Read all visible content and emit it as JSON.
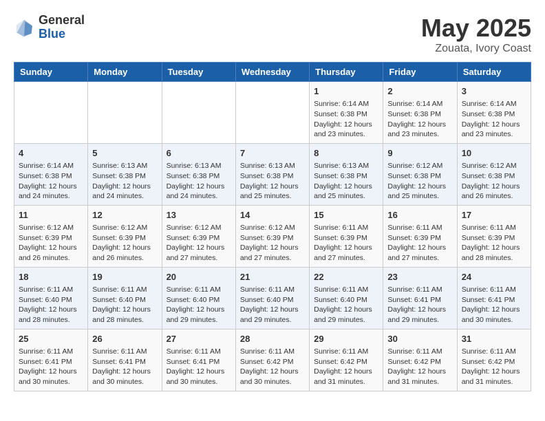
{
  "logo": {
    "general": "General",
    "blue": "Blue"
  },
  "title": "May 2025",
  "subtitle": "Zouata, Ivory Coast",
  "days_of_week": [
    "Sunday",
    "Monday",
    "Tuesday",
    "Wednesday",
    "Thursday",
    "Friday",
    "Saturday"
  ],
  "weeks": [
    [
      {
        "day": "",
        "info": ""
      },
      {
        "day": "",
        "info": ""
      },
      {
        "day": "",
        "info": ""
      },
      {
        "day": "",
        "info": ""
      },
      {
        "day": "1",
        "info": "Sunrise: 6:14 AM\nSunset: 6:38 PM\nDaylight: 12 hours and 23 minutes."
      },
      {
        "day": "2",
        "info": "Sunrise: 6:14 AM\nSunset: 6:38 PM\nDaylight: 12 hours and 23 minutes."
      },
      {
        "day": "3",
        "info": "Sunrise: 6:14 AM\nSunset: 6:38 PM\nDaylight: 12 hours and 23 minutes."
      }
    ],
    [
      {
        "day": "4",
        "info": "Sunrise: 6:14 AM\nSunset: 6:38 PM\nDaylight: 12 hours and 24 minutes."
      },
      {
        "day": "5",
        "info": "Sunrise: 6:13 AM\nSunset: 6:38 PM\nDaylight: 12 hours and 24 minutes."
      },
      {
        "day": "6",
        "info": "Sunrise: 6:13 AM\nSunset: 6:38 PM\nDaylight: 12 hours and 24 minutes."
      },
      {
        "day": "7",
        "info": "Sunrise: 6:13 AM\nSunset: 6:38 PM\nDaylight: 12 hours and 25 minutes."
      },
      {
        "day": "8",
        "info": "Sunrise: 6:13 AM\nSunset: 6:38 PM\nDaylight: 12 hours and 25 minutes."
      },
      {
        "day": "9",
        "info": "Sunrise: 6:12 AM\nSunset: 6:38 PM\nDaylight: 12 hours and 25 minutes."
      },
      {
        "day": "10",
        "info": "Sunrise: 6:12 AM\nSunset: 6:38 PM\nDaylight: 12 hours and 26 minutes."
      }
    ],
    [
      {
        "day": "11",
        "info": "Sunrise: 6:12 AM\nSunset: 6:39 PM\nDaylight: 12 hours and 26 minutes."
      },
      {
        "day": "12",
        "info": "Sunrise: 6:12 AM\nSunset: 6:39 PM\nDaylight: 12 hours and 26 minutes."
      },
      {
        "day": "13",
        "info": "Sunrise: 6:12 AM\nSunset: 6:39 PM\nDaylight: 12 hours and 27 minutes."
      },
      {
        "day": "14",
        "info": "Sunrise: 6:12 AM\nSunset: 6:39 PM\nDaylight: 12 hours and 27 minutes."
      },
      {
        "day": "15",
        "info": "Sunrise: 6:11 AM\nSunset: 6:39 PM\nDaylight: 12 hours and 27 minutes."
      },
      {
        "day": "16",
        "info": "Sunrise: 6:11 AM\nSunset: 6:39 PM\nDaylight: 12 hours and 27 minutes."
      },
      {
        "day": "17",
        "info": "Sunrise: 6:11 AM\nSunset: 6:39 PM\nDaylight: 12 hours and 28 minutes."
      }
    ],
    [
      {
        "day": "18",
        "info": "Sunrise: 6:11 AM\nSunset: 6:40 PM\nDaylight: 12 hours and 28 minutes."
      },
      {
        "day": "19",
        "info": "Sunrise: 6:11 AM\nSunset: 6:40 PM\nDaylight: 12 hours and 28 minutes."
      },
      {
        "day": "20",
        "info": "Sunrise: 6:11 AM\nSunset: 6:40 PM\nDaylight: 12 hours and 29 minutes."
      },
      {
        "day": "21",
        "info": "Sunrise: 6:11 AM\nSunset: 6:40 PM\nDaylight: 12 hours and 29 minutes."
      },
      {
        "day": "22",
        "info": "Sunrise: 6:11 AM\nSunset: 6:40 PM\nDaylight: 12 hours and 29 minutes."
      },
      {
        "day": "23",
        "info": "Sunrise: 6:11 AM\nSunset: 6:41 PM\nDaylight: 12 hours and 29 minutes."
      },
      {
        "day": "24",
        "info": "Sunrise: 6:11 AM\nSunset: 6:41 PM\nDaylight: 12 hours and 30 minutes."
      }
    ],
    [
      {
        "day": "25",
        "info": "Sunrise: 6:11 AM\nSunset: 6:41 PM\nDaylight: 12 hours and 30 minutes."
      },
      {
        "day": "26",
        "info": "Sunrise: 6:11 AM\nSunset: 6:41 PM\nDaylight: 12 hours and 30 minutes."
      },
      {
        "day": "27",
        "info": "Sunrise: 6:11 AM\nSunset: 6:41 PM\nDaylight: 12 hours and 30 minutes."
      },
      {
        "day": "28",
        "info": "Sunrise: 6:11 AM\nSunset: 6:42 PM\nDaylight: 12 hours and 30 minutes."
      },
      {
        "day": "29",
        "info": "Sunrise: 6:11 AM\nSunset: 6:42 PM\nDaylight: 12 hours and 31 minutes."
      },
      {
        "day": "30",
        "info": "Sunrise: 6:11 AM\nSunset: 6:42 PM\nDaylight: 12 hours and 31 minutes."
      },
      {
        "day": "31",
        "info": "Sunrise: 6:11 AM\nSunset: 6:42 PM\nDaylight: 12 hours and 31 minutes."
      }
    ]
  ]
}
